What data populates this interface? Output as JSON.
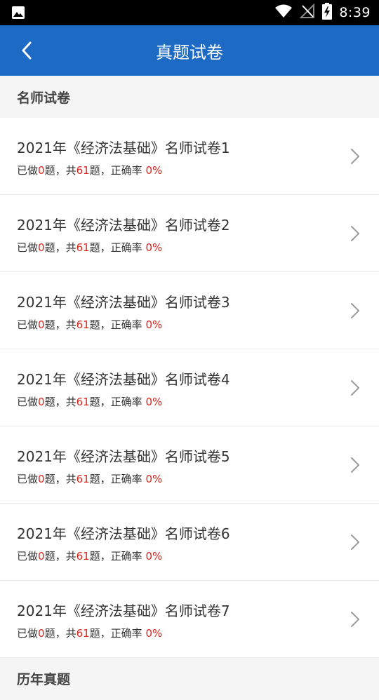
{
  "status_bar": {
    "time": "8:39",
    "icons": [
      "image-icon",
      "wifi-icon",
      "no-signal-icon",
      "battery-charging-icon"
    ]
  },
  "app_bar": {
    "title": "真题试卷",
    "back_icon": "chevron-left-icon"
  },
  "section": {
    "title": "名师试卷"
  },
  "items": [
    {
      "title": "2021年《经济法基础》名师试卷1",
      "done_prefix": "已做",
      "done": "0",
      "total_prefix": "题，共",
      "total": "61",
      "rate_prefix": "题，正确率 ",
      "rate": "0%"
    },
    {
      "title": "2021年《经济法基础》名师试卷2",
      "done_prefix": "已做",
      "done": "0",
      "total_prefix": "题，共",
      "total": "61",
      "rate_prefix": "题，正确率 ",
      "rate": "0%"
    },
    {
      "title": "2021年《经济法基础》名师试卷3",
      "done_prefix": "已做",
      "done": "0",
      "total_prefix": "题，共",
      "total": "61",
      "rate_prefix": "题，正确率 ",
      "rate": "0%"
    },
    {
      "title": "2021年《经济法基础》名师试卷4",
      "done_prefix": "已做",
      "done": "0",
      "total_prefix": "题，共",
      "total": "61",
      "rate_prefix": "题，正确率 ",
      "rate": "0%"
    },
    {
      "title": "2021年《经济法基础》名师试卷5",
      "done_prefix": "已做",
      "done": "0",
      "total_prefix": "题，共",
      "total": "61",
      "rate_prefix": "题，正确率 ",
      "rate": "0%"
    },
    {
      "title": "2021年《经济法基础》名师试卷6",
      "done_prefix": "已做",
      "done": "0",
      "total_prefix": "题，共",
      "total": "61",
      "rate_prefix": "题，正确率 ",
      "rate": "0%"
    },
    {
      "title": "2021年《经济法基础》名师试卷7",
      "done_prefix": "已做",
      "done": "0",
      "total_prefix": "题，共",
      "total": "61",
      "rate_prefix": "题，正确率 ",
      "rate": "0%"
    }
  ],
  "section2": {
    "title": "历年真题"
  },
  "colors": {
    "app_bar": "#1c6ac3",
    "highlight": "#d9241c",
    "background": "#f5f5f5"
  }
}
